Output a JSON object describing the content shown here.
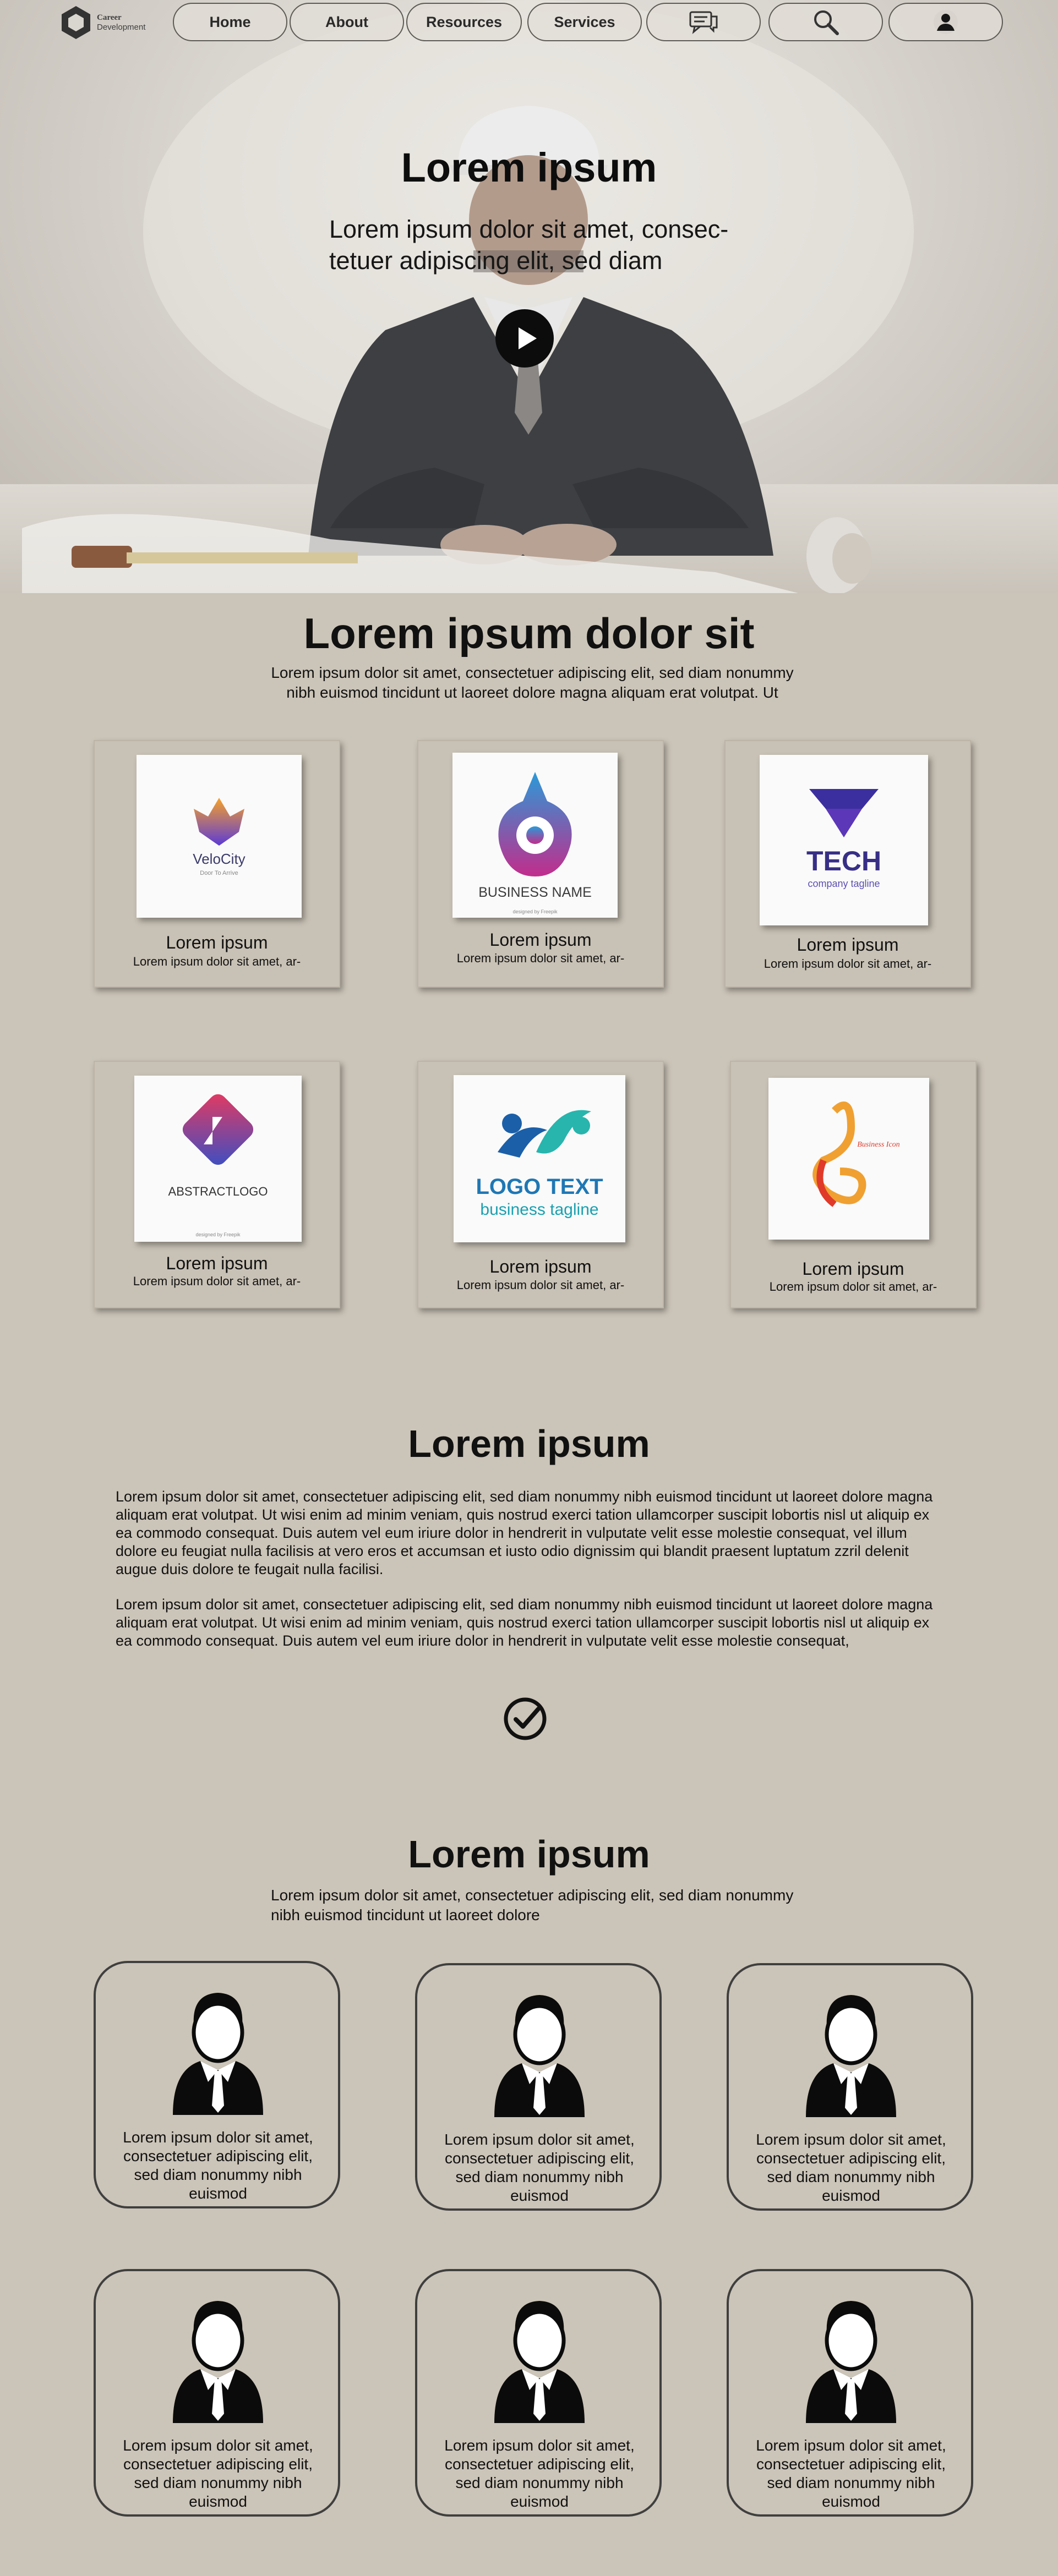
{
  "nav": {
    "logo_line1": "Career",
    "logo_line2": "Development",
    "items": [
      "Home",
      "About",
      "Resources",
      "Services"
    ],
    "icons": [
      "chat-icon",
      "search-icon",
      "user-icon"
    ]
  },
  "hero": {
    "title": "Lorem ipsum",
    "subtitle": "Lorem ipsum dolor sit amet, consec­tetuer adipiscing elit, sed diam"
  },
  "section2": {
    "title": "Lorem ipsum dolor sit",
    "text": "Lorem ipsum dolor sit amet, consectetuer adipiscing elit, sed diam nonum­my nibh euismod tincidunt ut laoreet dolore magna aliquam erat volutpat. Ut",
    "cards": [
      {
        "title": "Lorem ipsum",
        "text": "Lorem ipsum dolor sit amet, ar-",
        "logo_title": "VeloCity",
        "logo_sub": "Door To Arrive"
      },
      {
        "title": "Lorem ipsum",
        "text": "Lorem ipsum dolor sit amet, ar-",
        "logo_title": "BUSINESS NAME",
        "logo_sub": "designed by Freepik"
      },
      {
        "title": "Lorem ipsum",
        "text": "Lorem ipsum dolor sit amet, ar-",
        "logo_title": "TECH",
        "logo_sub": "company tagline"
      },
      {
        "title": "Lorem ipsum",
        "text": "Lorem ipsum dolor sit amet, ar-",
        "logo_title": "ABSTRACTLOGO",
        "logo_sub": "designed by Freepik"
      },
      {
        "title": "Lorem ipsum",
        "text": "Lorem ipsum dolor sit amet, ar-",
        "logo_title": "LOGO TEXT",
        "logo_sub": "business tagline"
      },
      {
        "title": "Lorem ipsum",
        "text": "Lorem ipsum dolor sit amet, ar-",
        "logo_title": "Business Icon",
        "logo_sub": ""
      }
    ]
  },
  "section3": {
    "title": "Lorem ipsum",
    "p1": "Lorem ipsum dolor sit amet, consectetuer adipiscing elit, sed diam nonummy nibh euismod tincidunt ut laoreet dolore magna aliquam erat volutpat. Ut wisi enim ad minim veniam, quis nostrud exerci tation ullamcorper suscipit lobortis nisl ut aliquip ex ea commodo consequat. Duis autem vel eum iriure dolor in hendrerit in vulputate velit esse molestie consequat, vel illum dolore eu feugiat nulla facilisis at vero eros et accumsan et iusto odio dignissim qui blandit praesent luptatum zzril delenit augue duis dolore te feugait nulla facilisi.",
    "p2": "Lorem ipsum dolor sit amet, consectetuer adipiscing elit, sed diam nonummy nibh euismod tincidunt ut laoreet dolore magna aliquam erat volutpat. Ut wisi enim ad minim veniam, quis nostrud exerci tation ullamcorper suscipit lobortis nisl ut aliquip ex ea commodo consequat. Duis autem vel eum iriure dolor in hendrerit in vulputate velit esse molestie consequat,"
  },
  "section4": {
    "title": "Lorem ipsum",
    "text": "Lorem ipsum dolor sit amet, consectetuer adipiscing elit, sed diam nonummy nibh euismod tincidunt ut laoreet dolore",
    "people": [
      {
        "text": "Lorem ipsum dolor sit amet, consectetuer adipiscing elit, sed diam nonummy nibh euismod"
      },
      {
        "text": "Lorem ipsum dolor sit amet, consectetuer adipiscing elit, sed diam nonummy nibh euismod"
      },
      {
        "text": "Lorem ipsum dolor sit amet, consectetuer adipiscing elit, sed diam nonummy nibh euismod"
      },
      {
        "text": "Lorem ipsum dolor sit amet, consectetuer adipiscing elit, sed diam nonummy nibh euismod"
      },
      {
        "text": "Lorem ipsum dolor sit amet, consectetuer adipiscing elit, sed diam nonummy nibh euismod"
      },
      {
        "text": "Lorem ipsum dolor sit amet, consectetuer adipiscing elit, sed diam nonummy nibh euismod"
      }
    ]
  }
}
